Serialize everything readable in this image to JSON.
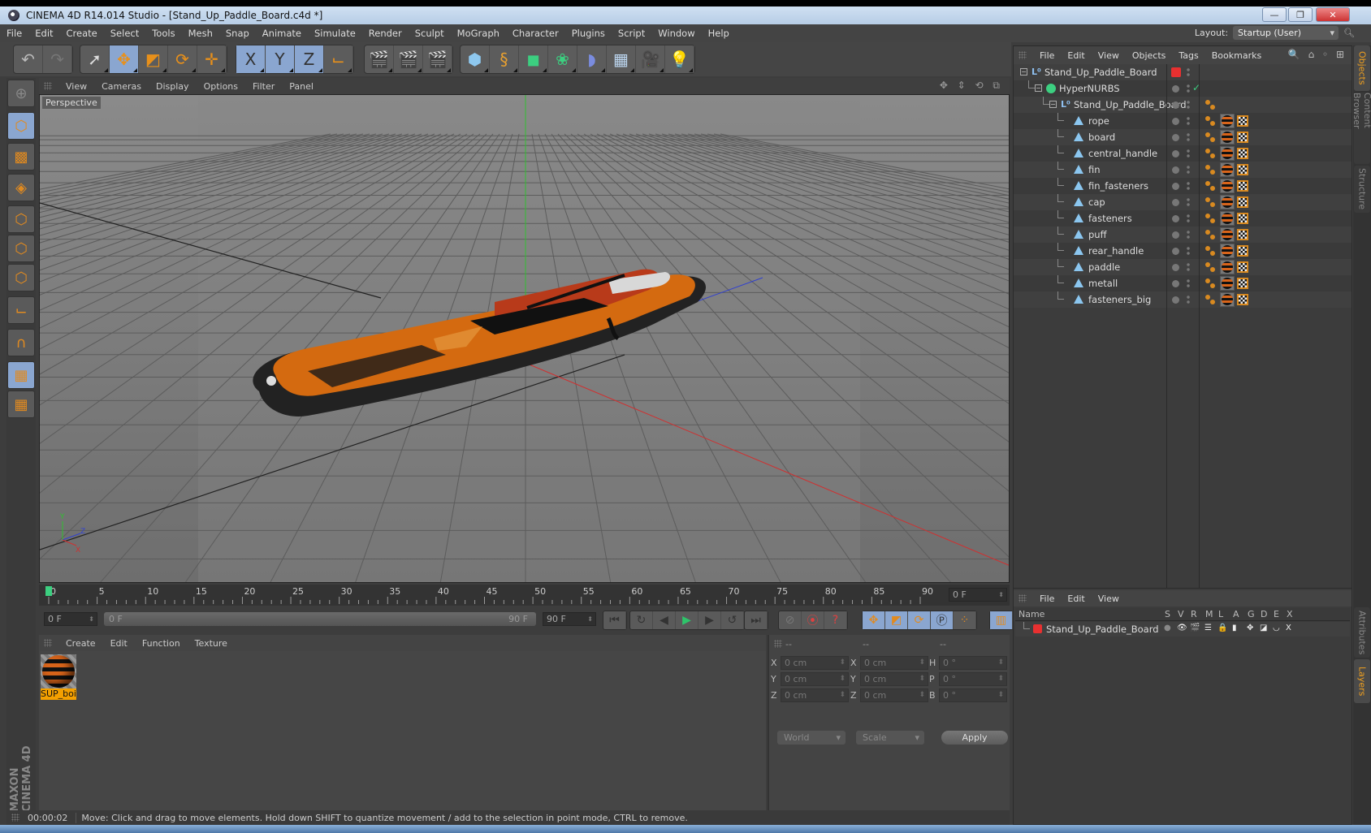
{
  "window": {
    "title": "CINEMA 4D R14.014 Studio - [Stand_Up_Paddle_Board.c4d *]",
    "controls": {
      "minimize": "—",
      "restore": "❐",
      "close": "✕"
    }
  },
  "menubar": {
    "items": [
      "File",
      "Edit",
      "Create",
      "Select",
      "Tools",
      "Mesh",
      "Snap",
      "Animate",
      "Simulate",
      "Render",
      "Sculpt",
      "MoGraph",
      "Character",
      "Plugins",
      "Script",
      "Window",
      "Help"
    ],
    "layout_label": "Layout:",
    "layout_value": "Startup (User)"
  },
  "toolbar": {
    "groups": [
      [
        {
          "icon": "undo-icon",
          "glyph": "↶"
        },
        {
          "icon": "redo-icon",
          "glyph": "↷"
        }
      ],
      [
        {
          "icon": "live-selection-icon",
          "glyph": "➚",
          "active": false
        },
        {
          "icon": "move-icon",
          "glyph": "✥",
          "active": true
        },
        {
          "icon": "scale-icon",
          "glyph": "◩"
        },
        {
          "icon": "rotate-icon",
          "glyph": "⟳"
        },
        {
          "icon": "recent-tool-icon",
          "glyph": "✛"
        }
      ],
      [
        {
          "icon": "x-axis-icon",
          "glyph": "X",
          "active": true
        },
        {
          "icon": "y-axis-icon",
          "glyph": "Y",
          "active": true
        },
        {
          "icon": "z-axis-icon",
          "glyph": "Z",
          "active": true
        },
        {
          "icon": "coordinate-system-icon",
          "glyph": "⌙"
        }
      ],
      [
        {
          "icon": "render-view-icon",
          "glyph": "🎬"
        },
        {
          "icon": "render-picture-viewer-icon",
          "glyph": "🎬"
        },
        {
          "icon": "render-settings-icon",
          "glyph": "🎬"
        }
      ],
      [
        {
          "icon": "cube-icon",
          "glyph": "⬢"
        },
        {
          "icon": "spline-icon",
          "glyph": "§"
        },
        {
          "icon": "nurbs-icon",
          "glyph": "◼"
        },
        {
          "icon": "array-icon",
          "glyph": "❀"
        },
        {
          "icon": "deformer-icon",
          "glyph": "◗"
        },
        {
          "icon": "floor-icon",
          "glyph": "▦"
        },
        {
          "icon": "camera-icon",
          "glyph": "🎥"
        },
        {
          "icon": "light-icon",
          "glyph": "💡"
        }
      ]
    ]
  },
  "left_toolbar": [
    {
      "icon": "make-editable-icon",
      "glyph": "⊕",
      "active": false
    },
    {
      "icon": "model-mode-icon",
      "glyph": "⬡",
      "active": true
    },
    {
      "icon": "texture-mode-icon",
      "glyph": "▩",
      "active": false
    },
    {
      "icon": "workplane-mode-icon",
      "glyph": "◈",
      "active": false
    },
    {
      "icon": "points-mode-icon",
      "glyph": "⬡",
      "active": false
    },
    {
      "icon": "edges-mode-icon",
      "glyph": "⬡",
      "active": false
    },
    {
      "icon": "polygons-mode-icon",
      "glyph": "⬡",
      "active": false
    },
    {
      "icon": "axis-mode-icon",
      "glyph": "⌙",
      "active": false
    },
    {
      "icon": "snap-magnet-icon",
      "glyph": "∩",
      "active": false
    },
    {
      "icon": "locked-workplane-icon",
      "glyph": "▦",
      "active": true
    },
    {
      "icon": "planar-workplane-icon",
      "glyph": "▦",
      "active": false
    }
  ],
  "brand": "MAXON CINEMA 4D",
  "viewport": {
    "menu": [
      "View",
      "Cameras",
      "Display",
      "Options",
      "Filter",
      "Panel"
    ],
    "camera_label": "Perspective",
    "nav_icons": "✥ ⇕ ⟲ ⧉",
    "axis_labels": {
      "x": "X",
      "y": "Y",
      "z": "Z"
    }
  },
  "timeline": {
    "ticks": [
      0,
      5,
      10,
      15,
      20,
      25,
      30,
      35,
      40,
      45,
      50,
      55,
      60,
      65,
      70,
      75,
      80,
      85,
      90
    ],
    "current_frame": "0 F",
    "start_field": "0 F",
    "range_start": "0 F",
    "range_end": "90 F",
    "end_field": "90 F"
  },
  "playback": {
    "buttons": [
      "go-to-start",
      "go-to-previous-key",
      "go-to-previous-frame",
      "play-forwards",
      "go-to-next-frame",
      "go-to-next-key",
      "go-to-end"
    ],
    "record_buttons": [
      "motion-recording",
      "record-active-objects",
      "autokeying"
    ],
    "key_buttons": [
      "position-key",
      "scale-key",
      "rotation-key",
      "parameter-key",
      "point-level-animation"
    ],
    "timeline_button": "timeline-icon"
  },
  "material_manager": {
    "menu": [
      "Create",
      "Edit",
      "Function",
      "Texture"
    ],
    "materials": [
      {
        "name": "SUP_boa",
        "label_shown": "SUP_boi"
      }
    ]
  },
  "coordinates": {
    "headers": [
      "--",
      "--",
      "--"
    ],
    "rows": [
      {
        "pos_label": "X",
        "pos": "0 cm",
        "size_label": "X",
        "size": "0 cm",
        "rot_label": "H",
        "rot": "0 °"
      },
      {
        "pos_label": "Y",
        "pos": "0 cm",
        "size_label": "Y",
        "size": "0 cm",
        "rot_label": "P",
        "rot": "0 °"
      },
      {
        "pos_label": "Z",
        "pos": "0 cm",
        "size_label": "Z",
        "size": "0 cm",
        "rot_label": "B",
        "rot": "0 °"
      }
    ],
    "mode": "World",
    "size_mode": "Scale",
    "apply": "Apply"
  },
  "object_manager": {
    "menu": [
      "File",
      "Edit",
      "View",
      "Objects",
      "Tags",
      "Bookmarks"
    ],
    "toolbar_icons": "🔍 ⌂ ◦ ⊞",
    "objects": [
      {
        "name": "Stand_Up_Paddle_Board",
        "type": "null",
        "depth": 0,
        "expanded": true,
        "layer_color": "#e83030",
        "tags": []
      },
      {
        "name": "HyperNURBS",
        "type": "hypernurbs",
        "depth": 1,
        "expanded": true,
        "enabled_check": true,
        "tags": []
      },
      {
        "name": "Stand_Up_Paddle_Board",
        "type": "null",
        "depth": 2,
        "expanded": true,
        "tags": [
          "phong"
        ]
      },
      {
        "name": "rope",
        "type": "polygon",
        "depth": 3,
        "tags": [
          "phong",
          "material",
          "uvw"
        ]
      },
      {
        "name": "board",
        "type": "polygon",
        "depth": 3,
        "tags": [
          "phong",
          "material",
          "uvw"
        ]
      },
      {
        "name": "central_handle",
        "type": "polygon",
        "depth": 3,
        "tags": [
          "phong",
          "material",
          "uvw"
        ]
      },
      {
        "name": "fin",
        "type": "polygon",
        "depth": 3,
        "tags": [
          "phong",
          "material",
          "uvw"
        ]
      },
      {
        "name": "fin_fasteners",
        "type": "polygon",
        "depth": 3,
        "tags": [
          "phong",
          "material",
          "uvw"
        ]
      },
      {
        "name": "cap",
        "type": "polygon",
        "depth": 3,
        "tags": [
          "phong",
          "material",
          "uvw"
        ]
      },
      {
        "name": "fasteners",
        "type": "polygon",
        "depth": 3,
        "tags": [
          "phong",
          "material",
          "uvw"
        ]
      },
      {
        "name": "puff",
        "type": "polygon",
        "depth": 3,
        "tags": [
          "phong",
          "material",
          "uvw"
        ]
      },
      {
        "name": "rear_handle",
        "type": "polygon",
        "depth": 3,
        "tags": [
          "phong",
          "material",
          "uvw"
        ]
      },
      {
        "name": "paddle",
        "type": "polygon",
        "depth": 3,
        "tags": [
          "phong",
          "material",
          "uvw"
        ]
      },
      {
        "name": "metall",
        "type": "polygon",
        "depth": 3,
        "tags": [
          "phong",
          "material",
          "uvw"
        ]
      },
      {
        "name": "fasteners_big",
        "type": "polygon",
        "depth": 3,
        "tags": [
          "phong",
          "material",
          "uvw"
        ]
      }
    ]
  },
  "side_tabs_top": [
    {
      "label": "Objects",
      "active": true
    },
    {
      "label": "Content Browser",
      "active": false
    },
    {
      "label": "Structure",
      "active": false
    }
  ],
  "side_tabs_bottom": [
    {
      "label": "Attributes",
      "active": false
    },
    {
      "label": "Layers",
      "active": true
    }
  ],
  "layer_manager": {
    "menu": [
      "File",
      "Edit",
      "View"
    ],
    "columns": [
      "Name",
      "S",
      "V",
      "R",
      "M",
      "L",
      "A",
      "G",
      "D",
      "E",
      "X"
    ],
    "layers": [
      {
        "name": "Stand_Up_Paddle_Board",
        "color": "#e83030",
        "flags": [
          "●",
          "👁",
          "🎬",
          "☰",
          "🔒",
          "▮",
          "✥",
          "◪",
          "◡",
          "X"
        ]
      }
    ]
  },
  "status": {
    "time": "00:00:02",
    "message": "Move: Click and drag to move elements. Hold down SHIFT to quantize movement / add to the selection in point mode, CTRL to remove."
  },
  "colors": {
    "accent_orange": "#f0a020",
    "active_blue": "#8aa6d0",
    "layer_red": "#e83030",
    "axis_x": "#d03030",
    "axis_y": "#30c030",
    "axis_z": "#3040d0"
  }
}
